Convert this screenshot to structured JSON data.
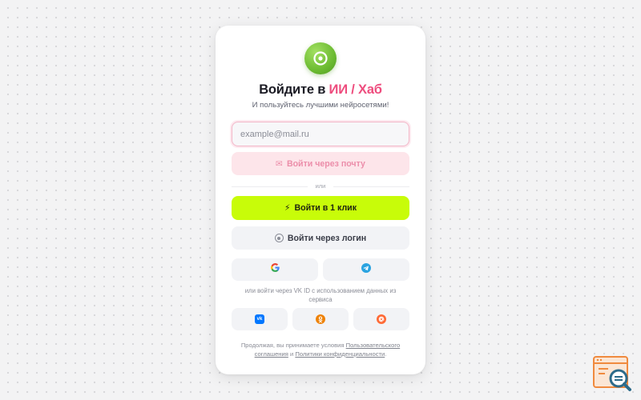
{
  "header": {
    "title_prefix": "Войдите в",
    "title_brand": "ИИ / Хаб",
    "subtitle": "И пользуйтесь лучшими нейросетями!"
  },
  "email": {
    "placeholder": "example@mail.ru",
    "value": ""
  },
  "buttons": {
    "email_icon": "✉",
    "email_label": "Войти через почту",
    "divider_label": "или",
    "oneclick_icon": "⚡",
    "oneclick_label": "Войти в 1 клик",
    "login_label": "Войти через логин"
  },
  "social": {
    "row1": [
      {
        "name": "google",
        "icon": "google-icon"
      },
      {
        "name": "telegram",
        "icon": "telegram-icon"
      }
    ],
    "vk_note": "или войти через VK ID с использованием данных из сервиса",
    "row2": [
      {
        "name": "vk",
        "icon": "vk-icon",
        "badge_text": "vk"
      },
      {
        "name": "odnoklassniki",
        "icon": "ok-icon"
      },
      {
        "name": "mail",
        "icon": "mail-ru-icon"
      }
    ]
  },
  "terms": {
    "prefix": "Продолжая, вы принимаете условия",
    "user_agreement": "Пользовательского соглашения",
    "and": "и",
    "privacy_policy": "Политики конфиденциальности",
    "suffix": "."
  },
  "colors": {
    "brand_accent": "#ee4d7e",
    "oneclick_bg": "#c8fc09",
    "email_button_bg": "#fde5ea",
    "logo_green": "#6cbb31",
    "card_bg": "#ffffff"
  },
  "widget": {
    "icon": "search-widget-icon"
  }
}
